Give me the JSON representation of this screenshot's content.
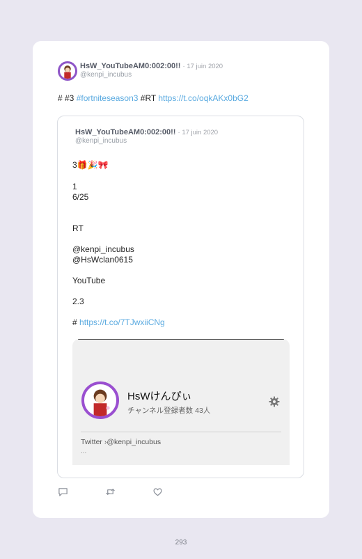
{
  "tweet": {
    "author_name": "HsW_YouTubeAM0:002:00!!",
    "date": "· 17 juin 2020",
    "handle": "@kenpi_incubus",
    "text_prefix": "# #3 ",
    "hashtag": "#fortniteseason3",
    "text_mid": " #RT ",
    "link": "https://t.co/oqkAKx0bG2"
  },
  "quote": {
    "author_name": "HsW_YouTubeAM0:002:00!!",
    "date": "· 17 juin 2020",
    "handle": "@kenpi_incubus",
    "line1": "3🎁🎉🎀",
    "line2": "1",
    "line3": "6/25",
    "line4": "RT",
    "mention1": "@kenpi_incubus",
    "mention2": "@HsWclan0615",
    "line5": "YouTube",
    "line6": "2.3",
    "line7_prefix": "# ",
    "line7_link": "https://t.co/7TJwxiiCNg"
  },
  "embed": {
    "channel_name": "HsWけんぴぃ",
    "subscribers": "チャンネル登録者数 43人",
    "twitter_label": "Twitter",
    "twitter_handle": "›@kenpi_incubus",
    "more": "..."
  },
  "actions": {
    "reply_icon": "reply-icon",
    "retweet_icon": "retweet-icon",
    "like_icon": "like-icon"
  },
  "page": {
    "number": "293"
  },
  "colors": {
    "background": "#e9e7f1",
    "link": "#5aaae0",
    "avatar_ring": "#8e55c7"
  }
}
